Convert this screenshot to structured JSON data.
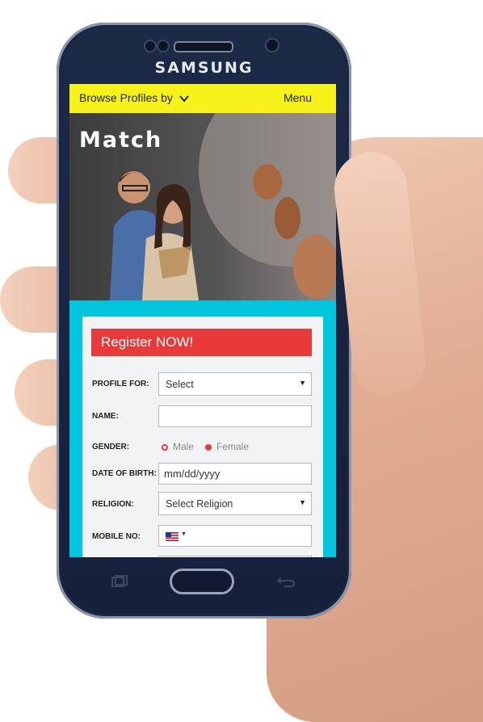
{
  "phone": {
    "brand": "SAMSUNG"
  },
  "topbar": {
    "browse_label": "Browse Profiles by",
    "chevron_icon": "chevron-down-icon",
    "menu_label": "Menu",
    "bg": "#f6f21a"
  },
  "hero": {
    "title": "Match"
  },
  "form": {
    "banner": "Register NOW!",
    "banner_color": "#e93a3a",
    "profile_for": {
      "label": "PROFILE FOR:",
      "value": "Select"
    },
    "name": {
      "label": "NAME:",
      "value": ""
    },
    "gender": {
      "label": "GENDER:",
      "male": "Male",
      "female": "Female",
      "selected": "Female"
    },
    "dob": {
      "label": "DATE OF BIRTH:",
      "placeholder": "mm/dd/yyyy"
    },
    "religion": {
      "label": "RELIGION:",
      "value": "Select Religion"
    },
    "mobile": {
      "label": "MOBILE NO:",
      "flag_icon": "us-flag-icon",
      "value": ""
    }
  },
  "colors": {
    "accent": "#00c5dd",
    "bar": "#f6f21a",
    "banner": "#e93a3a"
  }
}
